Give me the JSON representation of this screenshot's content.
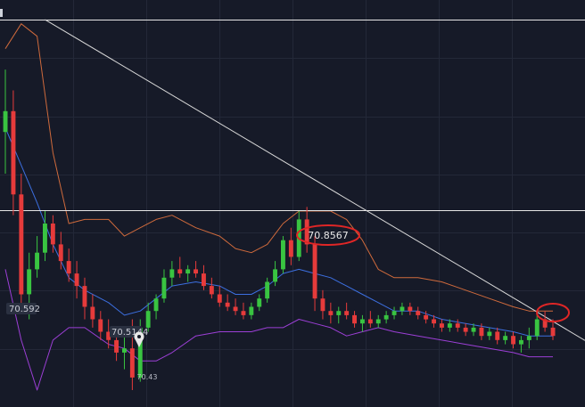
{
  "chart_data": {
    "type": "candlestick",
    "price_range": [
      70.4,
      71.35
    ],
    "horizontal_lines": [
      71.32,
      70.862
    ],
    "trendline": {
      "from": {
        "bar": 5,
        "price": 71.32
      },
      "to": {
        "bar": 69,
        "price": 70.595
      }
    },
    "annotations": {
      "resistance_label": "70.8567",
      "left_label": "70.592",
      "mid_label": "70.5144",
      "low_label": "70.43"
    },
    "candles": [
      [
        71.05,
        71.2,
        70.95,
        71.1
      ],
      [
        71.1,
        71.15,
        70.85,
        70.9
      ],
      [
        70.9,
        70.95,
        70.62,
        70.66
      ],
      [
        70.66,
        70.76,
        70.6,
        70.72
      ],
      [
        70.72,
        70.8,
        70.7,
        70.76
      ],
      [
        70.76,
        70.86,
        70.74,
        70.83
      ],
      [
        70.83,
        70.85,
        70.76,
        70.78
      ],
      [
        70.78,
        70.81,
        70.72,
        70.74
      ],
      [
        70.74,
        70.77,
        70.69,
        70.71
      ],
      [
        70.71,
        70.74,
        70.65,
        70.68
      ],
      [
        70.68,
        70.7,
        70.6,
        70.63
      ],
      [
        70.63,
        70.66,
        70.58,
        70.6
      ],
      [
        70.6,
        70.62,
        70.55,
        70.57
      ],
      [
        70.57,
        70.6,
        70.53,
        70.55
      ],
      [
        70.55,
        70.58,
        70.5,
        70.52
      ],
      [
        70.52,
        70.56,
        70.48,
        70.53
      ],
      [
        70.53,
        70.6,
        70.43,
        70.46
      ],
      [
        70.46,
        70.6,
        70.45,
        70.58
      ],
      [
        70.58,
        70.64,
        70.57,
        70.62
      ],
      [
        70.62,
        70.66,
        70.6,
        70.65
      ],
      [
        70.65,
        70.72,
        70.64,
        70.7
      ],
      [
        70.7,
        70.74,
        70.68,
        70.72
      ],
      [
        70.72,
        70.75,
        70.7,
        70.71
      ],
      [
        70.71,
        70.73,
        70.69,
        70.72
      ],
      [
        70.72,
        70.74,
        70.7,
        70.71
      ],
      [
        70.71,
        70.73,
        70.67,
        70.68
      ],
      [
        70.68,
        70.7,
        70.65,
        70.66
      ],
      [
        70.66,
        70.68,
        70.63,
        70.64
      ],
      [
        70.64,
        70.66,
        70.62,
        70.63
      ],
      [
        70.63,
        70.65,
        70.61,
        70.62
      ],
      [
        70.62,
        70.64,
        70.6,
        70.61
      ],
      [
        70.61,
        70.64,
        70.6,
        70.63
      ],
      [
        70.63,
        70.66,
        70.62,
        70.65
      ],
      [
        70.65,
        70.7,
        70.64,
        70.69
      ],
      [
        70.69,
        70.74,
        70.68,
        70.72
      ],
      [
        70.72,
        70.8,
        70.71,
        70.79
      ],
      [
        70.79,
        70.82,
        70.73,
        70.75
      ],
      [
        70.75,
        70.86,
        70.74,
        70.84
      ],
      [
        70.84,
        70.87,
        70.76,
        70.78
      ],
      [
        70.78,
        70.8,
        70.62,
        70.65
      ],
      [
        70.65,
        70.67,
        70.6,
        70.62
      ],
      [
        70.62,
        70.64,
        70.59,
        70.61
      ],
      [
        70.61,
        70.63,
        70.59,
        70.62
      ],
      [
        70.62,
        70.64,
        70.6,
        70.61
      ],
      [
        70.61,
        70.62,
        70.58,
        70.59
      ],
      [
        70.59,
        70.61,
        70.57,
        70.6
      ],
      [
        70.6,
        70.62,
        70.58,
        70.59
      ],
      [
        70.59,
        70.61,
        70.58,
        70.6
      ],
      [
        70.6,
        70.62,
        70.59,
        70.61
      ],
      [
        70.61,
        70.63,
        70.6,
        70.62
      ],
      [
        70.62,
        70.64,
        70.61,
        70.63
      ],
      [
        70.63,
        70.64,
        70.61,
        70.62
      ],
      [
        70.62,
        70.63,
        70.6,
        70.61
      ],
      [
        70.61,
        70.62,
        70.59,
        70.6
      ],
      [
        70.6,
        70.61,
        70.58,
        70.59
      ],
      [
        70.59,
        70.6,
        70.57,
        70.58
      ],
      [
        70.58,
        70.6,
        70.57,
        70.59
      ],
      [
        70.59,
        70.6,
        70.57,
        70.58
      ],
      [
        70.58,
        70.59,
        70.56,
        70.57
      ],
      [
        70.57,
        70.59,
        70.56,
        70.58
      ],
      [
        70.58,
        70.59,
        70.55,
        70.56
      ],
      [
        70.56,
        70.58,
        70.55,
        70.57
      ],
      [
        70.57,
        70.58,
        70.54,
        70.55
      ],
      [
        70.55,
        70.57,
        70.54,
        70.56
      ],
      [
        70.56,
        70.57,
        70.53,
        70.54
      ],
      [
        70.54,
        70.56,
        70.52,
        70.55
      ],
      [
        70.55,
        70.58,
        70.53,
        70.56
      ],
      [
        70.56,
        70.61,
        70.55,
        70.6
      ],
      [
        70.6,
        70.62,
        70.57,
        70.58
      ],
      [
        70.58,
        70.6,
        70.55,
        70.56
      ]
    ],
    "upper_band": [
      [
        0,
        71.25
      ],
      [
        2,
        71.31
      ],
      [
        4,
        71.28
      ],
      [
        6,
        71.0
      ],
      [
        8,
        70.83
      ],
      [
        10,
        70.84
      ],
      [
        13,
        70.84
      ],
      [
        15,
        70.8
      ],
      [
        17,
        70.82
      ],
      [
        19,
        70.84
      ],
      [
        21,
        70.85
      ],
      [
        24,
        70.82
      ],
      [
        27,
        70.8
      ],
      [
        29,
        70.77
      ],
      [
        31,
        70.76
      ],
      [
        33,
        70.78
      ],
      [
        35,
        70.83
      ],
      [
        37,
        70.86
      ],
      [
        39,
        70.86
      ],
      [
        41,
        70.86
      ],
      [
        43,
        70.84
      ],
      [
        45,
        70.79
      ],
      [
        47,
        70.72
      ],
      [
        49,
        70.7
      ],
      [
        52,
        70.7
      ],
      [
        55,
        70.69
      ],
      [
        58,
        70.67
      ],
      [
        61,
        70.65
      ],
      [
        64,
        70.63
      ],
      [
        66,
        70.62
      ],
      [
        68,
        70.62
      ],
      [
        69,
        70.62
      ]
    ],
    "middle_band": [
      [
        0,
        71.06
      ],
      [
        2,
        70.97
      ],
      [
        4,
        70.88
      ],
      [
        6,
        70.78
      ],
      [
        8,
        70.7
      ],
      [
        10,
        70.67
      ],
      [
        13,
        70.64
      ],
      [
        15,
        70.61
      ],
      [
        17,
        70.62
      ],
      [
        19,
        70.65
      ],
      [
        21,
        70.68
      ],
      [
        24,
        70.69
      ],
      [
        27,
        70.68
      ],
      [
        29,
        70.66
      ],
      [
        31,
        70.66
      ],
      [
        33,
        70.68
      ],
      [
        35,
        70.71
      ],
      [
        37,
        70.72
      ],
      [
        39,
        70.71
      ],
      [
        41,
        70.7
      ],
      [
        43,
        70.68
      ],
      [
        45,
        70.66
      ],
      [
        47,
        70.64
      ],
      [
        49,
        70.62
      ],
      [
        52,
        70.62
      ],
      [
        55,
        70.6
      ],
      [
        58,
        70.59
      ],
      [
        61,
        70.58
      ],
      [
        64,
        70.57
      ],
      [
        66,
        70.56
      ],
      [
        68,
        70.56
      ],
      [
        69,
        70.56
      ]
    ],
    "lower_band": [
      [
        0,
        70.72
      ],
      [
        2,
        70.55
      ],
      [
        4,
        70.43
      ],
      [
        6,
        70.55
      ],
      [
        8,
        70.58
      ],
      [
        10,
        70.58
      ],
      [
        13,
        70.54
      ],
      [
        15,
        70.53
      ],
      [
        17,
        70.5
      ],
      [
        19,
        70.5
      ],
      [
        21,
        70.52
      ],
      [
        24,
        70.56
      ],
      [
        27,
        70.57
      ],
      [
        29,
        70.57
      ],
      [
        31,
        70.57
      ],
      [
        33,
        70.58
      ],
      [
        35,
        70.58
      ],
      [
        37,
        70.6
      ],
      [
        39,
        70.59
      ],
      [
        41,
        70.58
      ],
      [
        43,
        70.56
      ],
      [
        45,
        70.57
      ],
      [
        47,
        70.58
      ],
      [
        49,
        70.57
      ],
      [
        52,
        70.56
      ],
      [
        55,
        70.55
      ],
      [
        58,
        70.54
      ],
      [
        61,
        70.53
      ],
      [
        64,
        70.52
      ],
      [
        66,
        70.51
      ],
      [
        68,
        70.51
      ],
      [
        69,
        70.51
      ]
    ],
    "colors": {
      "background": "#161a28",
      "grid": "#232838",
      "bull": "#39c441",
      "bear": "#e63b3b",
      "upper_band": "#cf6a3c",
      "middle_band": "#3c6fe0",
      "lower_band": "#9c3fd6",
      "hline": "#e6e6e6",
      "trendline": "#d8d8d8",
      "ellipse": "#e02626"
    }
  }
}
